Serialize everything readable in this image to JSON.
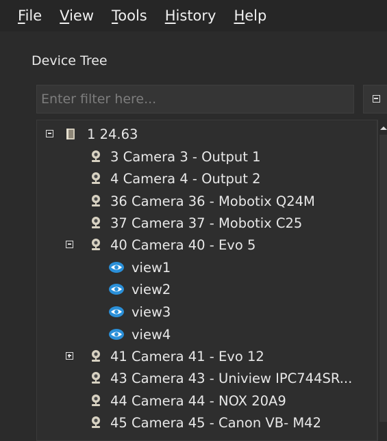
{
  "menu": {
    "file_rest": "ile",
    "file_u": "F",
    "view_rest": "iew",
    "view_u": "V",
    "tools_rest": "ools",
    "tools_u": "T",
    "history_rest": "istory",
    "history_u": "H",
    "help_rest": "elp",
    "help_u": "H"
  },
  "panel": {
    "title": "Device Tree"
  },
  "filter": {
    "placeholder": "Enter filter here..."
  },
  "tree": {
    "server": "1 24.63",
    "cameras": [
      "3 Camera 3 - Output 1",
      "4 Camera 4 - Output 2",
      "36 Camera 36 - Mobotix Q24M",
      "37 Camera 37 - Mobotix C25",
      "40 Camera 40 - Evo 5"
    ],
    "views": [
      "view1",
      "view2",
      "view3",
      "view4"
    ],
    "more_cameras": [
      "41 Camera 41 - Evo 12",
      "43 Camera 43 - Uniview IPC744SR...",
      "44 Camera 44 - NOX 20A9",
      "45 Camera 45 - Canon VB- M42"
    ]
  },
  "colors": {
    "background": "#2b2b2b",
    "view_icon": "#2a8fd8",
    "text": "#e8e8e8"
  }
}
